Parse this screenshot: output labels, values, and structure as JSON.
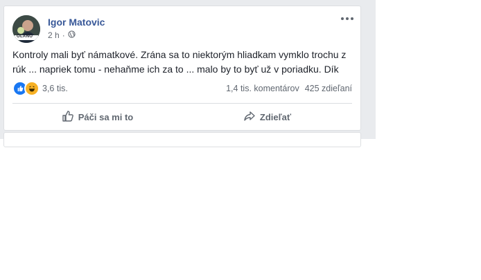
{
  "post": {
    "author": "Igor Matovic",
    "avatar_badge": "OLANO",
    "time": "2 h",
    "privacy_icon": "globe-icon",
    "text": "Kontroly mali byť námatkové. Zrána sa to niektorým hliadkam vymklo trochu z rúk ... napriek tomu - nehaňme ich za to ... malo by to byť už v poriadku. Dík",
    "reactions": {
      "types": [
        "like-icon",
        "haha-icon"
      ],
      "count": "3,6 tis."
    },
    "comments": "1,4 tis. komentárov",
    "shares": "425 zdieľaní",
    "actions": {
      "like": "Páči sa mi to",
      "share": "Zdieľať"
    }
  },
  "colors": {
    "author_link": "#385898",
    "like_blue": "#1877f2",
    "haha_yellow": "#f7b125",
    "feed_bg": "#e9ebee"
  }
}
